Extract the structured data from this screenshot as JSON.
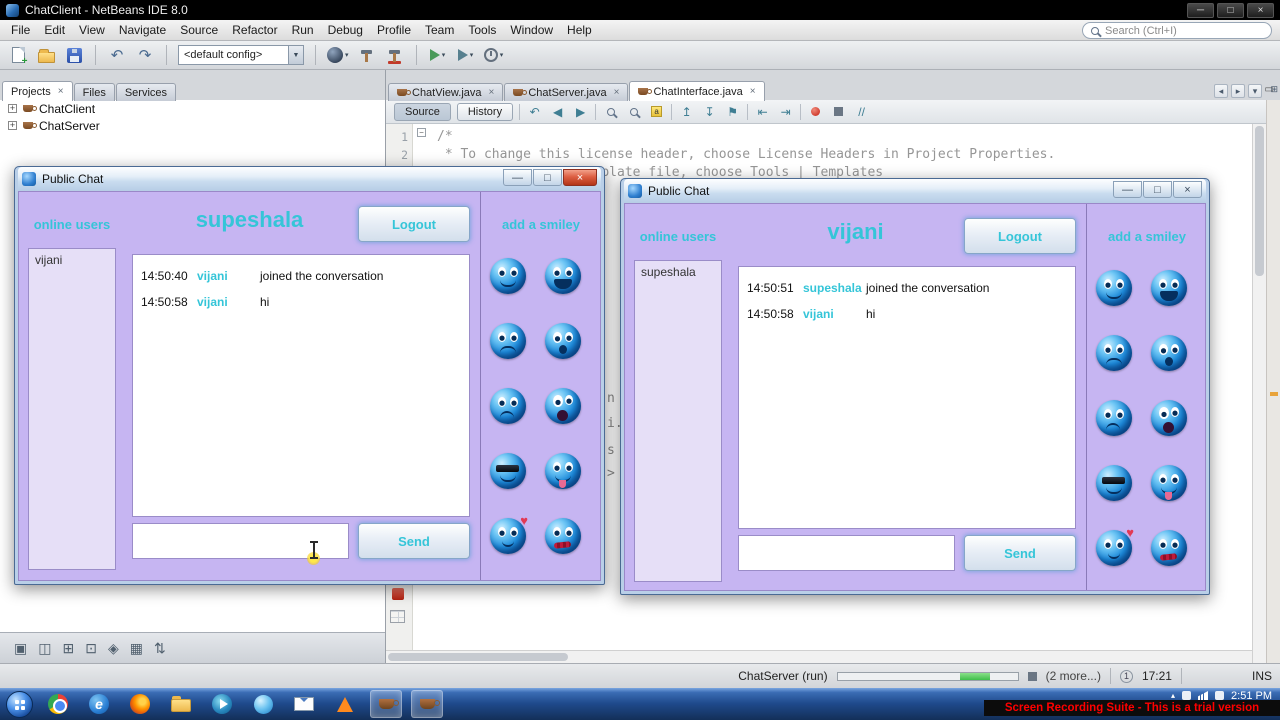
{
  "titlebar": {
    "title": "ChatClient - NetBeans IDE 8.0"
  },
  "menubar": {
    "items": [
      "File",
      "Edit",
      "View",
      "Navigate",
      "Source",
      "Refactor",
      "Run",
      "Debug",
      "Profile",
      "Team",
      "Tools",
      "Window",
      "Help"
    ],
    "search_placeholder": "Search (Ctrl+I)"
  },
  "toolbar": {
    "config_value": "<default config>"
  },
  "left_panel": {
    "tabs": [
      {
        "label": "Projects"
      },
      {
        "label": "Files"
      },
      {
        "label": "Services"
      }
    ],
    "tree": [
      {
        "label": "ChatClient"
      },
      {
        "label": "ChatServer"
      }
    ]
  },
  "editor": {
    "tabs": [
      {
        "label": "ChatView.java"
      },
      {
        "label": "ChatServer.java"
      },
      {
        "label": "ChatInterface.java"
      }
    ],
    "view_buttons": [
      "Source",
      "History"
    ],
    "code_lines": [
      {
        "num": "1",
        "text": "/*"
      },
      {
        "num": "2",
        "text": " * To change this license header, choose License Headers in Project Properties."
      },
      {
        "num": "3",
        "text": " * To change this template file, choose Tools | Templates"
      }
    ],
    "fragments": [
      "n",
      "i.",
      "s",
      ">"
    ]
  },
  "status_bar": {
    "task_label": "ChatServer (run)",
    "more_label": "(2 more...)",
    "notification_count": "1",
    "caret_position": "17:21",
    "insert_mode": "INS"
  },
  "chat_windows": [
    {
      "title": "Public Chat",
      "online_users_label": "online users",
      "users": [
        "vijani"
      ],
      "username": "supeshala",
      "logout_label": "Logout",
      "send_label": "Send",
      "smiley_label": "add a smiley",
      "input_value": "",
      "messages": [
        {
          "time": "14:50:40",
          "user": "vijani",
          "text": "joined the conversation"
        },
        {
          "time": "14:50:58",
          "user": "vijani",
          "text": "hi"
        }
      ]
    },
    {
      "title": "Public Chat",
      "online_users_label": "online users",
      "users": [
        "supeshala"
      ],
      "username": "vijani",
      "logout_label": "Logout",
      "send_label": "Send",
      "smiley_label": "add a smiley",
      "input_value": "",
      "messages": [
        {
          "time": "14:50:51",
          "user": "supeshala",
          "text": "joined the conversation"
        },
        {
          "time": "14:50:58",
          "user": "vijani",
          "text": "hi"
        }
      ]
    }
  ],
  "smilies": [
    "smile",
    "laugh",
    "angry",
    "surprised",
    "mad",
    "shocked",
    "cool",
    "tongue",
    "love",
    "sick"
  ],
  "taskbar": {
    "time": "2:51 PM"
  },
  "trial_banner": "Screen Recording Suite - This is a trial version",
  "colors": {
    "accent_cyan": "#35c5d8",
    "chat_lavender": "#c6b5f2",
    "trial_red": "#ff0000",
    "progress_green": "#3fbf4a",
    "taskbar_blue": "#1f4a8c"
  }
}
